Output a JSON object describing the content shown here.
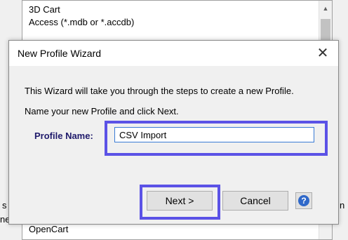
{
  "background_list": {
    "items": [
      "3D Cart",
      "Access (*.mdb or *.accdb)",
      "OpenCart"
    ],
    "edge_left_chars": [
      "s",
      "ne"
    ],
    "edge_right_char": "n"
  },
  "dialog": {
    "title": "New Profile Wizard",
    "close_glyph": "✕",
    "intro_text": "This Wizard will take you through the steps to create a new Profile.",
    "instruction_text": "Name your new Profile and click Next.",
    "profile_name_label": "Profile Name:",
    "profile_name_value": "CSV Import",
    "next_label": "Next >",
    "cancel_label": "Cancel",
    "help_glyph": "?"
  },
  "colors": {
    "highlight": "#5b52e6",
    "label": "#1f1a6b",
    "help_icon": "#2f68c9"
  }
}
